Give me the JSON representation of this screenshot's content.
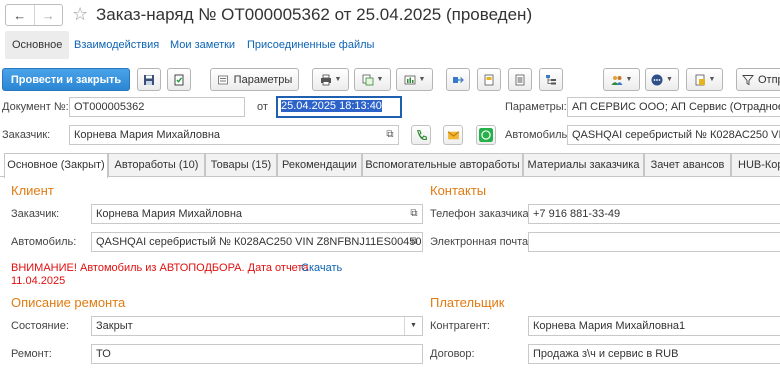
{
  "window": {
    "title": "Заказ-наряд № ОТ000005362 от 25.04.2025 (проведен)",
    "back_glyph": "←",
    "forward_glyph": "→",
    "star_glyph": "☆"
  },
  "top_tabs": {
    "main": "Основное",
    "interactions": "Взаимодействия",
    "notes": "Мои заметки",
    "files": "Присоединенные файлы"
  },
  "toolbar": {
    "post_close": "Провести и закрыть",
    "parameters": "Параметры",
    "overflow_label": "Отпр",
    "icons": [
      "save-icon",
      "post-icon",
      "print-icon",
      "create-based-icon",
      "reports-icon",
      "move-icon",
      "doc-icon",
      "list-icon",
      "structure-icon",
      "users-icon",
      "more-icon",
      "attach-icon",
      "filter-icon"
    ]
  },
  "header_form": {
    "doc_label": "Документ №:",
    "doc_number": "ОТ000005362",
    "date_label": "от",
    "date_value": "25.04.2025 18:13:40",
    "params_label": "Параметры:",
    "params_value": "АП СЕРВИС ООО; АП Сервис (Отрадное) ",
    "customer_label": "Заказчик:",
    "customer_value": "Корнева Мария Михайловна",
    "car_label": "Автомобиль:",
    "car_value": "QASHQAI серебристый № К028АС250 VIN "
  },
  "content_tabs": [
    "Основное (Закрыт)",
    "Автоработы (10)",
    "Товары (15)",
    "Рекомендации",
    "Вспомогательные автоработы",
    "Материалы заказчика",
    "Зачет авансов",
    "HUB-Кор"
  ],
  "client": {
    "title": "Клиент",
    "customer_label": "Заказчик:",
    "customer_value": "Корнева Мария Михайловна",
    "car_label": "Автомобиль:",
    "car_value": "QASHQAI серебристый № К028АС250 VIN Z8NFBNJ11ES00450",
    "warning_line1": "ВНИМАНИЕ! Автомобиль из АВТОПОДБОРА. Дата отчета",
    "warning_line2": "11.04.2025",
    "download_link": "Скачать"
  },
  "contacts": {
    "title": "Контакты",
    "phone_label": "Телефон заказчика:",
    "phone_value": "+7 916 881-33-49",
    "email_label": "Электронная почта:",
    "email_value": ""
  },
  "repair": {
    "title": "Описание ремонта",
    "state_label": "Состояние:",
    "state_value": "Закрыт",
    "repair_label": "Ремонт:",
    "repair_value": "ТО"
  },
  "payer": {
    "title": "Плательщик",
    "counterparty_label": "Контрагент:",
    "counterparty_value": "Корнева Мария Михайловна1",
    "contract_label": "Договор:",
    "contract_value": "Продажа з\\ч и сервис в RUB"
  }
}
